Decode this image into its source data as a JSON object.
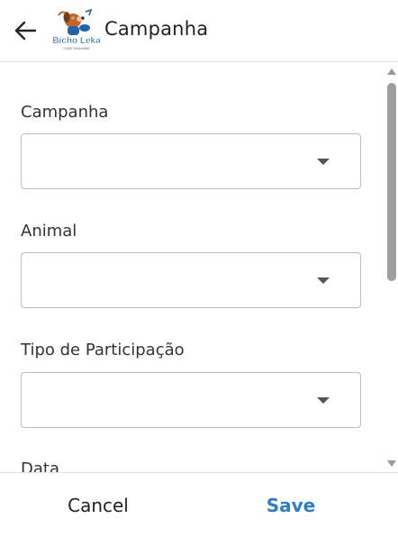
{
  "header": {
    "title": "Campanha",
    "back_icon": "arrow-left-icon",
    "logo": {
      "text": "Bicho Leka",
      "tagline": "CUIDE PARA AMAR"
    }
  },
  "form": {
    "fields": [
      {
        "label": "Campanha",
        "value": "",
        "icon": "caret-down-icon"
      },
      {
        "label": "Animal",
        "value": "",
        "icon": "caret-down-icon"
      },
      {
        "label": "Tipo de Participação",
        "value": "",
        "icon": "caret-down-icon"
      },
      {
        "label": "Data"
      }
    ]
  },
  "footer": {
    "cancel_label": "Cancel",
    "save_label": "Save"
  },
  "colors": {
    "accent": "#2f7cc7",
    "logo_blue": "#1e63b0",
    "logo_dog": "#c0662a",
    "border": "#bdbdbd"
  }
}
